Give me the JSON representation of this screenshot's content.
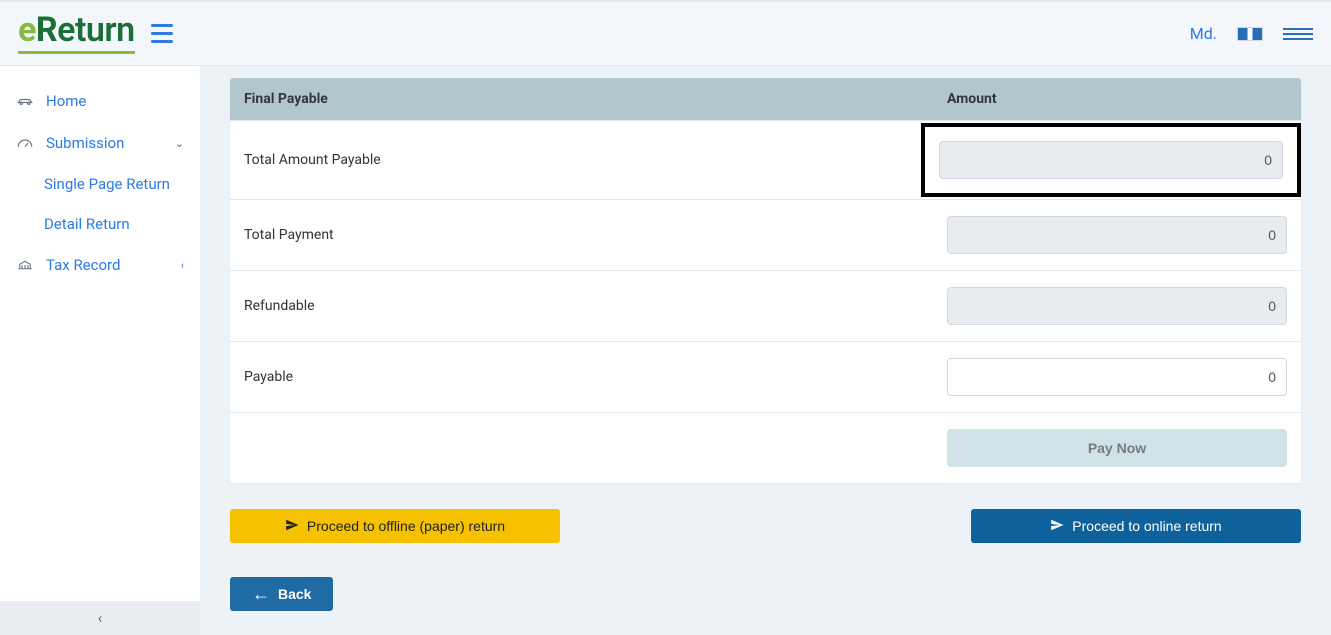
{
  "header": {
    "logo_e": "e",
    "logo_r": "R",
    "logo_rest": "eturn",
    "user_name": "Md."
  },
  "sidebar": {
    "home": "Home",
    "submission": "Submission",
    "single_page": "Single Page Return",
    "detail_return": "Detail Return",
    "tax_record": "Tax Record"
  },
  "table": {
    "header_label": "Final Payable",
    "header_amount": "Amount",
    "rows": {
      "total_amount_payable": {
        "label": "Total Amount Payable",
        "value": "0"
      },
      "total_payment": {
        "label": "Total Payment",
        "value": "0"
      },
      "refundable": {
        "label": "Refundable",
        "value": "0"
      },
      "payable": {
        "label": "Payable",
        "value": "0"
      }
    },
    "pay_now": "Pay Now"
  },
  "actions": {
    "offline": "Proceed to offline (paper) return",
    "online": "Proceed to online return",
    "back": "Back"
  }
}
